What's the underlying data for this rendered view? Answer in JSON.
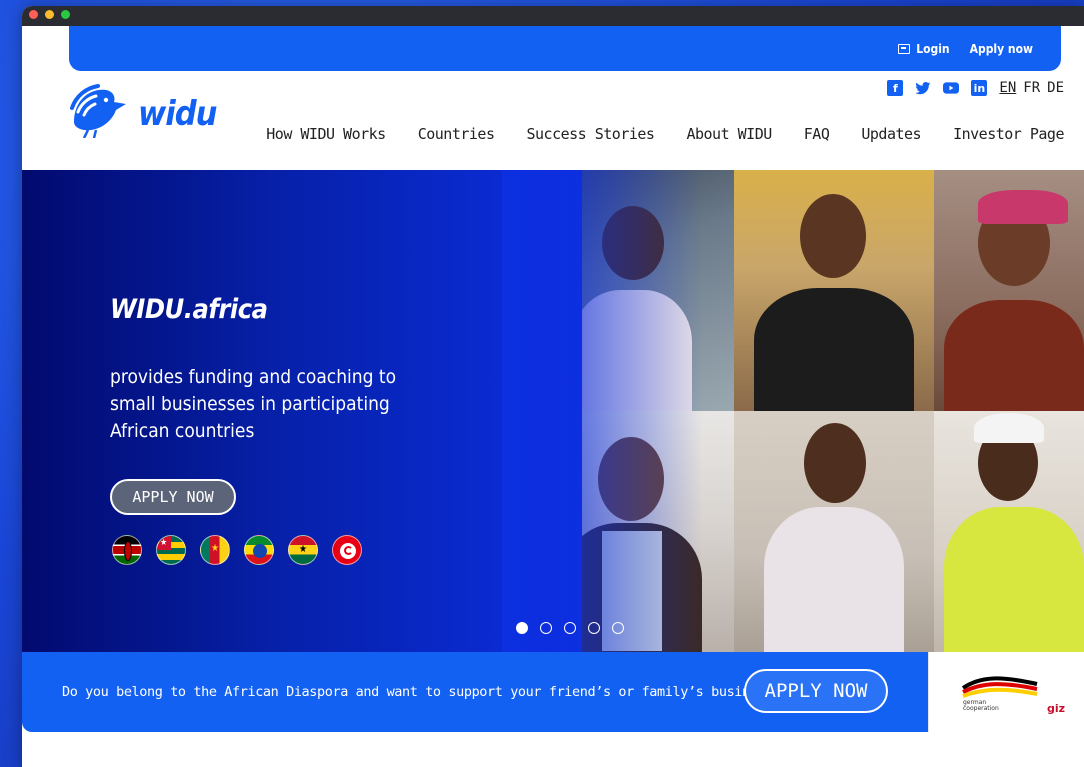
{
  "window": {
    "traffic_lights": [
      "close",
      "minimize",
      "maximize"
    ]
  },
  "topbar": {
    "login_label": "Login",
    "apply_label": "Apply now",
    "accent_color": "#1361f2"
  },
  "header": {
    "logo_text": "widu",
    "social": [
      {
        "name": "facebook-icon",
        "glyph": "f"
      },
      {
        "name": "twitter-icon",
        "glyph": "🐦"
      },
      {
        "name": "youtube-icon",
        "glyph": "▶"
      },
      {
        "name": "linkedin-icon",
        "glyph": "in"
      }
    ],
    "languages": [
      {
        "code": "EN",
        "active": true
      },
      {
        "code": "FR",
        "active": false
      },
      {
        "code": "DE",
        "active": false
      }
    ],
    "nav": [
      "How WIDU Works",
      "Countries",
      "Success Stories",
      "About WIDU",
      "FAQ",
      "Updates",
      "Investor Page"
    ]
  },
  "hero": {
    "title": "WIDU.africa",
    "text": "provides funding and coaching to small businesses in participating African countries",
    "apply_label": "APPLY NOW",
    "flags": [
      "kenya-flag",
      "togo-flag",
      "cameroon-flag",
      "ethiopia-flag",
      "ghana-flag",
      "tunisia-flag"
    ],
    "carousel": {
      "count": 5,
      "active": 0
    }
  },
  "diaspora": {
    "text": "Do you belong to the African Diaspora and want to support your friend’s or family’s business?",
    "apply_label": "APPLY NOW"
  },
  "partner": {
    "org_line1": "german",
    "org_line2": "cooperation",
    "org2": "giz"
  }
}
